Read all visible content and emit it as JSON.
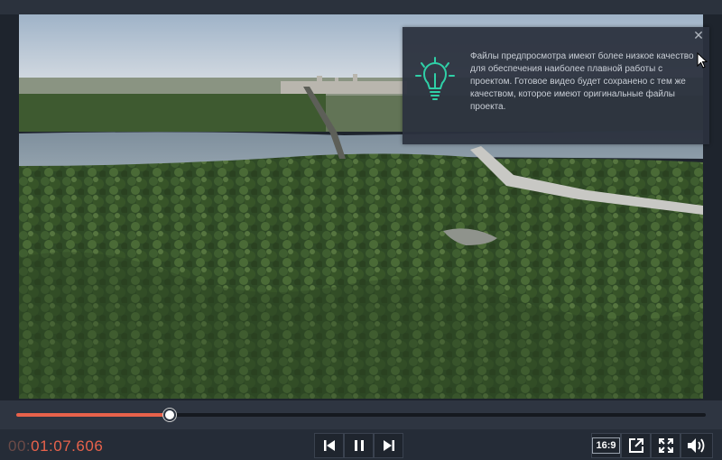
{
  "player": {
    "tooltip": {
      "text": "Файлы предпросмотра имеют более низкое качество для обеспечения наиболее плавной работы с проектом. Готовое видео будет сохранено с тем же качеством, которое имеют оригинальные файлы проекта.",
      "close_icon": "close-icon",
      "icon": "lightbulb-icon"
    },
    "progress": {
      "position_percent": 22.3,
      "accent_color": "#e8624b"
    },
    "timecode": {
      "lead": "00:",
      "main": "01:07.606"
    },
    "controls": {
      "prev_icon": "skip-back-icon",
      "pause_icon": "pause-icon",
      "next_icon": "skip-forward-icon",
      "aspect_ratio": "16:9",
      "popout_icon": "popout-icon",
      "fullscreen_icon": "fullscreen-icon",
      "volume_icon": "volume-icon"
    }
  }
}
